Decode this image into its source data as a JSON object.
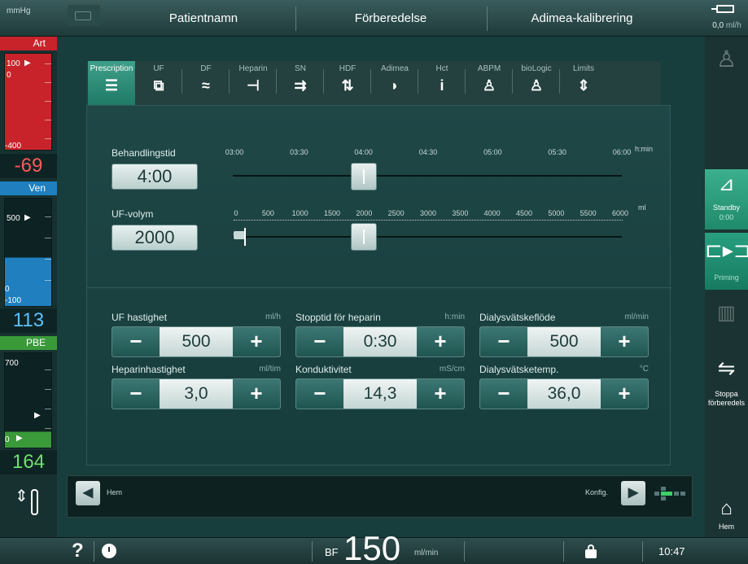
{
  "topbar": {
    "unit": "mmHg",
    "tabs": [
      "Patientnamn",
      "Förberedelse",
      "Adimea-kalibrering"
    ],
    "right_value": "0,0",
    "right_unit": "ml/h"
  },
  "pressures": {
    "art": {
      "label": "Art",
      "top": "100",
      "zero": "0",
      "bottom": "-400",
      "value": "-69"
    },
    "ven": {
      "label": "Ven",
      "top": "500",
      "zero": "0",
      "bottom": "-100",
      "value": "113"
    },
    "pbe": {
      "label": "PBE",
      "top": "700",
      "zero": "0",
      "value": "164"
    }
  },
  "tabs": [
    {
      "label": "Prescription",
      "icon": "prescription-icon",
      "glyph": "☰"
    },
    {
      "label": "UF",
      "icon": "uf-icon",
      "glyph": "⧉"
    },
    {
      "label": "DF",
      "icon": "df-icon",
      "glyph": "≈"
    },
    {
      "label": "Heparin",
      "icon": "syringe-icon",
      "glyph": "⊣"
    },
    {
      "label": "SN",
      "icon": "single-needle-icon",
      "glyph": "⇉"
    },
    {
      "label": "HDF",
      "icon": "hdf-icon",
      "glyph": "⇅"
    },
    {
      "label": "Adimea",
      "icon": "adimea-icon",
      "glyph": "◗"
    },
    {
      "label": "Hct",
      "icon": "hct-icon",
      "glyph": "i"
    },
    {
      "label": "ABPM",
      "icon": "abpm-icon",
      "glyph": "♙"
    },
    {
      "label": "bioLogic",
      "icon": "biologic-icon",
      "glyph": "♙"
    },
    {
      "label": "Limits",
      "icon": "limits-icon",
      "glyph": "⇕"
    }
  ],
  "treatment_time": {
    "label": "Behandlingstid",
    "value": "4:00",
    "ticks": [
      "03:00",
      "03:30",
      "04:00",
      "04:30",
      "05:00",
      "05:30",
      "06:00"
    ],
    "unit": "h:min",
    "min_h": 3.0,
    "max_h": 6.0,
    "current_h": 4.0
  },
  "uf_volume": {
    "label": "UF-volym",
    "value": "2000",
    "ticks": [
      "0",
      "500",
      "1000",
      "1500",
      "2000",
      "2500",
      "3000",
      "3500",
      "4000",
      "4500",
      "5000",
      "5500",
      "6000"
    ],
    "unit": "ml",
    "min": 0,
    "max": 6000,
    "current": 2000
  },
  "steppers": [
    {
      "label": "UF hastighet",
      "unit": "ml/h",
      "value": "500"
    },
    {
      "label": "Stopptid för heparin",
      "unit": "h:min",
      "value": "0:30"
    },
    {
      "label": "Dialysvätskeflöde",
      "unit": "ml/min",
      "value": "500"
    },
    {
      "label": "Heparinhastighet",
      "unit": "ml/tim",
      "value": "3,0"
    },
    {
      "label": "Konduktivitet",
      "unit": "mS/cm",
      "value": "14,3"
    },
    {
      "label": "Dialysvätsketemp.",
      "unit": "°C",
      "value": "36,0"
    }
  ],
  "nav": {
    "back_label": "Hem",
    "config_label": "Konfig."
  },
  "right": {
    "standby_label": "Standby",
    "standby_time": "0:00",
    "priming_label": "Priming",
    "stop_prep_label": "Stoppa förberedels",
    "home_label": "Hem"
  },
  "footer": {
    "bf_label": "BF",
    "bf_value": "150",
    "bf_unit": "ml/min",
    "time": "10:47",
    "help": "?"
  }
}
